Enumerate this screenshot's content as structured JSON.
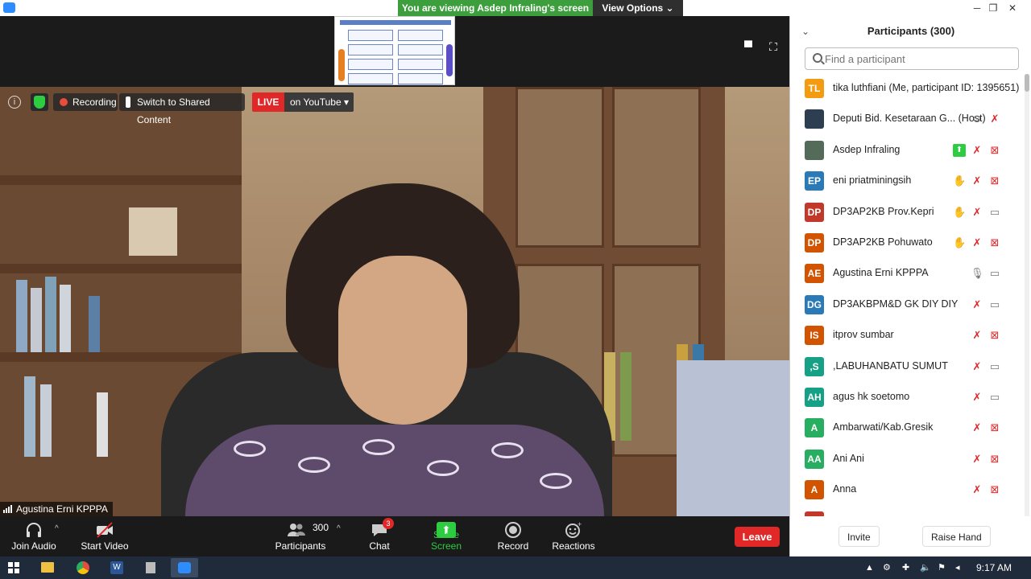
{
  "window": {
    "banner": "You are viewing Asdep Infraling's screen",
    "view_options": "View Options ⌄",
    "minimize": "─",
    "maximize": "❐",
    "close": "✕"
  },
  "overlay": {
    "info_icon": "i",
    "recording": "Recording",
    "switch": "Switch to Shared Content",
    "live": "LIVE",
    "youtube": "on YouTube ▾"
  },
  "speaker": {
    "name": "Agustina Erni KPPPA"
  },
  "toolbar": {
    "join_audio": "Join Audio",
    "start_video": "Start Video",
    "participants_count": "300",
    "participants": "Participants",
    "chat": "Chat",
    "chat_badge": "3",
    "share_screen": "Share Screen",
    "record": "Record",
    "reactions": "Reactions",
    "leave": "Leave",
    "caret": "^"
  },
  "panel": {
    "title": "Participants (300)",
    "collapse": "⌄",
    "search_placeholder": "Find a participant",
    "invite": "Invite",
    "raise_hand": "Raise Hand",
    "participants": [
      {
        "initials": "TL",
        "color": "#f39c12",
        "name": "tika luthfiani (Me, participant ID: 1395651)",
        "icons": []
      },
      {
        "initials": "",
        "color": "#2c3e50",
        "name": "Deputi Bid. Kesetaraan G... (Host)",
        "icons": [
          "host-icon",
          "mic-off-icon"
        ]
      },
      {
        "initials": "",
        "color": "#556b5a",
        "name": "Asdep Infraling",
        "icons": [
          "share-icon",
          "mic-off-icon",
          "cam-off-icon"
        ]
      },
      {
        "initials": "EP",
        "color": "#2a7ab8",
        "name": "eni priatminingsih",
        "icons": [
          "hand-icon",
          "mic-off-icon",
          "cam-off-icon"
        ]
      },
      {
        "initials": "DP",
        "color": "#c0392b",
        "name": "DP3AP2KB Prov.Kepri",
        "icons": [
          "hand-icon",
          "mic-off-icon",
          "cam-on-icon"
        ]
      },
      {
        "initials": "DP",
        "color": "#d35400",
        "name": "DP3AP2KB Pohuwato",
        "icons": [
          "hand-icon",
          "mic-off-icon",
          "cam-off-icon"
        ]
      },
      {
        "initials": "AE",
        "color": "#d35400",
        "name": "Agustina Erni KPPPA",
        "icons": [
          "mic-on-icon",
          "cam-on-icon"
        ]
      },
      {
        "initials": "DG",
        "color": "#2a7ab8",
        "name": " DP3AKBPM&D GK DIY DIY",
        "icons": [
          "mic-off-icon",
          "cam-on-icon"
        ]
      },
      {
        "initials": "IS",
        "color": "#d35400",
        "name": " itprov sumbar",
        "icons": [
          "mic-off-icon",
          "cam-off-icon"
        ]
      },
      {
        "initials": ",S",
        "color": "#16a085",
        "name": ",LABUHANBATU SUMUT",
        "icons": [
          "mic-off-icon",
          "cam-on-icon"
        ]
      },
      {
        "initials": "AH",
        "color": "#16a085",
        "name": "agus hk soetomo",
        "icons": [
          "mic-off-icon",
          "cam-on-icon"
        ]
      },
      {
        "initials": "A",
        "color": "#27ae60",
        "name": "Ambarwati/Kab.Gresik",
        "icons": [
          "mic-off-icon",
          "cam-off-icon"
        ]
      },
      {
        "initials": "AA",
        "color": "#27ae60",
        "name": "Ani Ani",
        "icons": [
          "mic-off-icon",
          "cam-off-icon"
        ]
      },
      {
        "initials": "A",
        "color": "#d35400",
        "name": "Anna",
        "icons": [
          "mic-off-icon",
          "cam-off-icon"
        ]
      },
      {
        "initials": "",
        "color": "#c0392b",
        "name": "",
        "icons": []
      }
    ]
  },
  "taskbar": {
    "clock": "9:17 AM"
  },
  "colors": {
    "banner_green": "#3c9e3c",
    "live_red": "#e02828",
    "share_green": "#2ecc40",
    "zoom_blue": "#2d8cff"
  }
}
